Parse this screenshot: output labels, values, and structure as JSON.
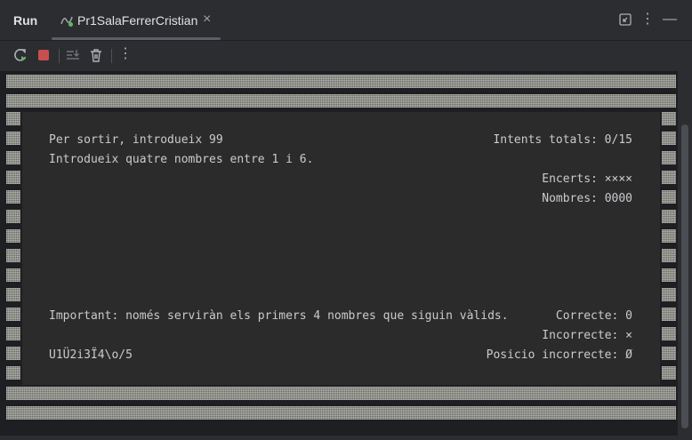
{
  "header": {
    "run_title": "Run",
    "tab_label": "Pr1SalaFerrerCristian",
    "tab_close": "×",
    "more_menu": "⋮",
    "minimize": "—"
  },
  "toolbar": {
    "more": "⋮"
  },
  "console": {
    "exit_hint": "Per sortir, introdueix 99",
    "attempts": "Intents totals: 0/15",
    "instruction": "Introdueix quatre nombres entre 1 i 6.",
    "hits": "Encerts: ××××",
    "numbers": "Nombres: 0000",
    "important": "Important: només serviràn els primers 4 nombres que siguin vàlids.",
    "correct": "Correcte: 0",
    "incorrect": "Incorrecte: ×",
    "input_echo": "U1Ü2i3Ï4\\o/5",
    "wrong_position": "Posicio incorrecte: Ø"
  },
  "colors": {
    "background": "#2b2d30",
    "console_bg": "#1e1f22",
    "pane_bg": "#2b2b2b",
    "text": "#c9cbcf",
    "stop_red": "#c94f4f",
    "rerun_green": "#5fb865"
  }
}
